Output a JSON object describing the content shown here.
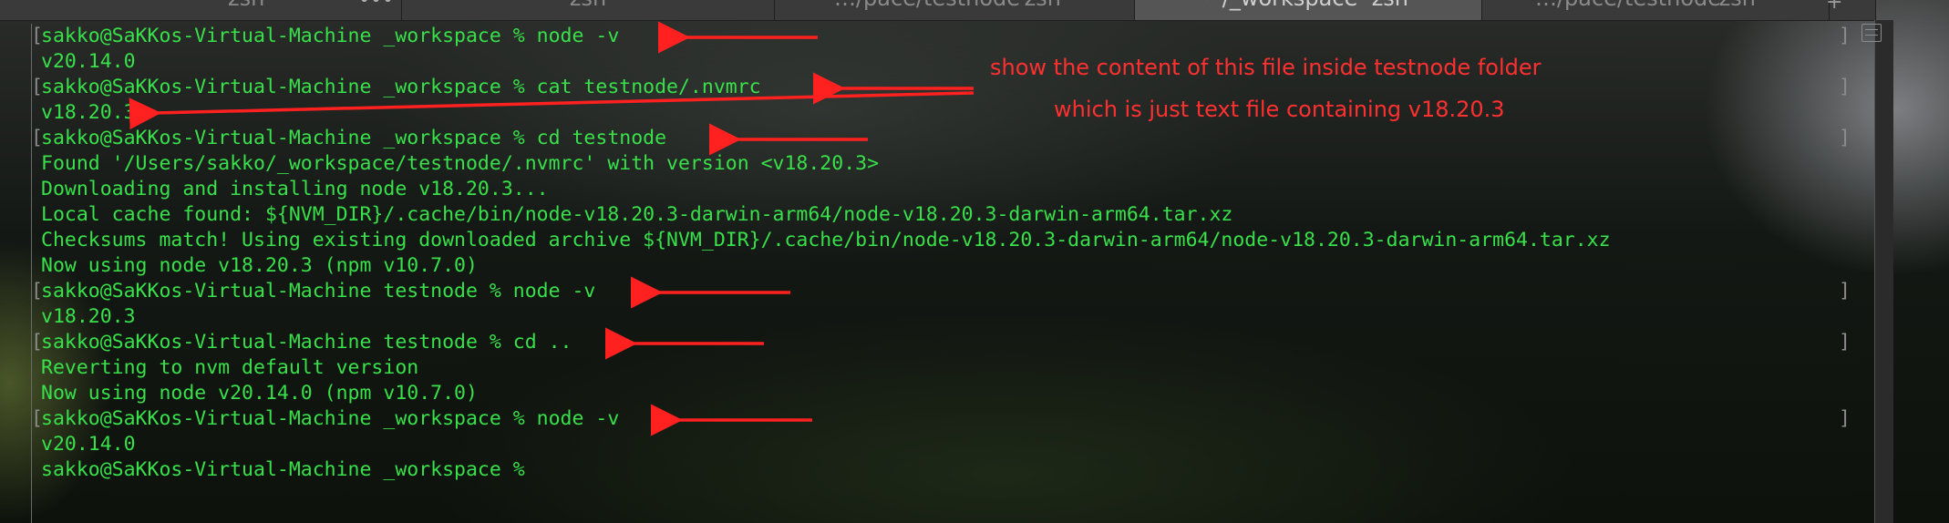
{
  "tabs": [
    {
      "title": "zsh",
      "shell": "",
      "dots": "•••",
      "active": false
    },
    {
      "title": "zsh",
      "shell": "",
      "active": false
    },
    {
      "title": "…/pace/testnode",
      "shell": "zsh",
      "active": false
    },
    {
      "title": "~/_workspace",
      "shell": "zsh",
      "active": true
    },
    {
      "title": "…/pace/testnode",
      "shell": "zsh",
      "active": false
    }
  ],
  "new_tab": "+",
  "terminal": {
    "lines": [
      {
        "text": "sakko@SaKKos-Virtual-Machine _workspace % node -v",
        "prompt": true
      },
      {
        "text": "v20.14.0",
        "prompt": false
      },
      {
        "text": "sakko@SaKKos-Virtual-Machine _workspace % cat testnode/.nvmrc",
        "prompt": true
      },
      {
        "text": "v18.20.3",
        "prompt": false
      },
      {
        "text": "sakko@SaKKos-Virtual-Machine _workspace % cd testnode",
        "prompt": true
      },
      {
        "text": "Found '/Users/sakko/_workspace/testnode/.nvmrc' with version <v18.20.3>",
        "prompt": false
      },
      {
        "text": "Downloading and installing node v18.20.3...",
        "prompt": false
      },
      {
        "text": "Local cache found: ${NVM_DIR}/.cache/bin/node-v18.20.3-darwin-arm64/node-v18.20.3-darwin-arm64.tar.xz",
        "prompt": false
      },
      {
        "text": "Checksums match! Using existing downloaded archive ${NVM_DIR}/.cache/bin/node-v18.20.3-darwin-arm64/node-v18.20.3-darwin-arm64.tar.xz",
        "prompt": false
      },
      {
        "text": "Now using node v18.20.3 (npm v10.7.0)",
        "prompt": false
      },
      {
        "text": "sakko@SaKKos-Virtual-Machine testnode % node -v",
        "prompt": true
      },
      {
        "text": "v18.20.3",
        "prompt": false
      },
      {
        "text": "sakko@SaKKos-Virtual-Machine testnode % cd ..",
        "prompt": true
      },
      {
        "text": "Reverting to nvm default version",
        "prompt": false
      },
      {
        "text": "Now using node v20.14.0 (npm v10.7.0)",
        "prompt": false
      },
      {
        "text": "sakko@SaKKos-Virtual-Machine _workspace % node -v",
        "prompt": true
      },
      {
        "text": "v20.14.0",
        "prompt": false
      },
      {
        "text": "sakko@SaKKos-Virtual-Machine _workspace %",
        "prompt": false
      }
    ]
  },
  "annotations": {
    "note_line1": "show the content of this file inside testnode folder",
    "note_line2": "which is just text file containing v18.20.3",
    "color": "#ff2020"
  },
  "icons": {
    "split_pane": "split-pane-icon"
  }
}
